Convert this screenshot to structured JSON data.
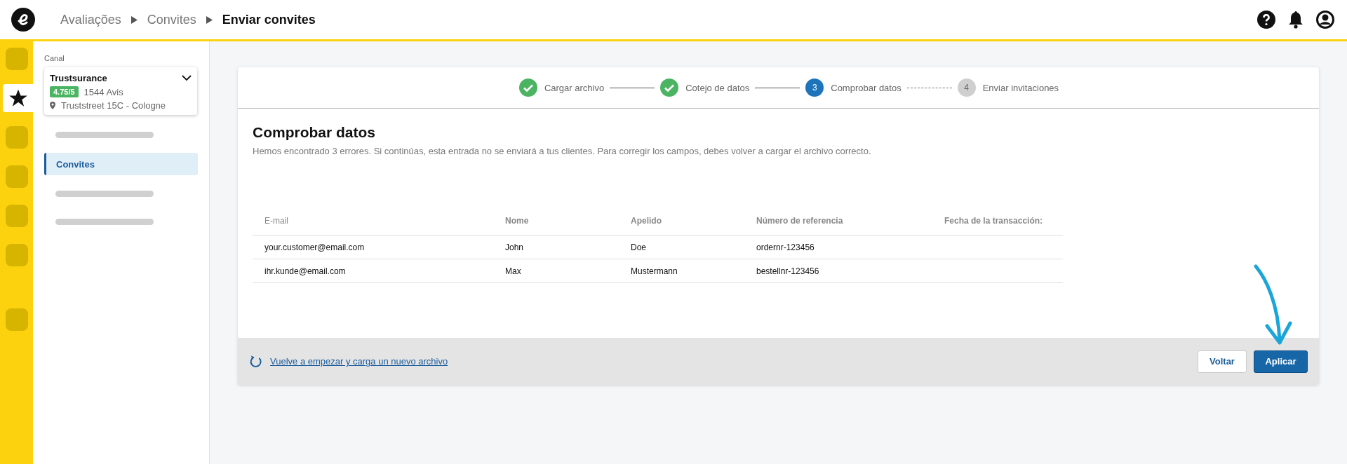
{
  "header": {
    "breadcrumbs": [
      {
        "label": "Avaliações",
        "current": false
      },
      {
        "label": "Convites",
        "current": false
      },
      {
        "label": "Enviar convites",
        "current": true
      }
    ]
  },
  "rail": [
    {
      "kind": "blank",
      "selected": false
    },
    {
      "kind": "star",
      "selected": true
    },
    {
      "kind": "blank",
      "selected": false
    },
    {
      "kind": "blank",
      "selected": false
    },
    {
      "kind": "blank",
      "selected": false
    },
    {
      "kind": "blank",
      "selected": false
    },
    {
      "kind": "bottom",
      "selected": false
    }
  ],
  "sidebar": {
    "section_label": "Canal",
    "channel": {
      "name": "Trustsurance",
      "rating": "4.75/5",
      "reviews": "1544 Avis",
      "address": "Truststreet 15C - Cologne"
    },
    "items": [
      {
        "kind": "skeleton"
      },
      {
        "kind": "link",
        "label": "Convites",
        "selected": true
      },
      {
        "kind": "skeleton"
      },
      {
        "kind": "skeleton"
      }
    ]
  },
  "stepper": [
    {
      "label": "Cargar archivo",
      "kind": "done"
    },
    {
      "label": "Cotejo de datos",
      "kind": "done"
    },
    {
      "number": "3",
      "label": "Comprobar datos",
      "kind": "current"
    },
    {
      "number": "4",
      "label": "Enviar invitaciones",
      "kind": "pending"
    }
  ],
  "content": {
    "title": "Comprobar datos",
    "message": "Hemos encontrado 3 errores. Si continúas, esta entrada no se enviará a tus clientes. Para corregir los campos, debes volver a cargar el archivo correcto."
  },
  "table": {
    "columns": [
      "E-mail",
      "Nome",
      "Apelido",
      "Número de referencia",
      "Fecha de la transacción:"
    ],
    "rows": [
      [
        "your.customer@email.com",
        "John",
        "Doe",
        "ordernr-123456"
      ],
      [
        "ihr.kunde@email.com",
        "Max",
        "Mustermann",
        "bestellnr-123456"
      ]
    ]
  },
  "footer": {
    "restart_link": "Vuelve a empezar y carga un nuevo archivo",
    "buttons": [
      {
        "label": "Voltar",
        "kind": "secondary"
      },
      {
        "label": "Aplicar",
        "kind": "primary"
      }
    ]
  }
}
